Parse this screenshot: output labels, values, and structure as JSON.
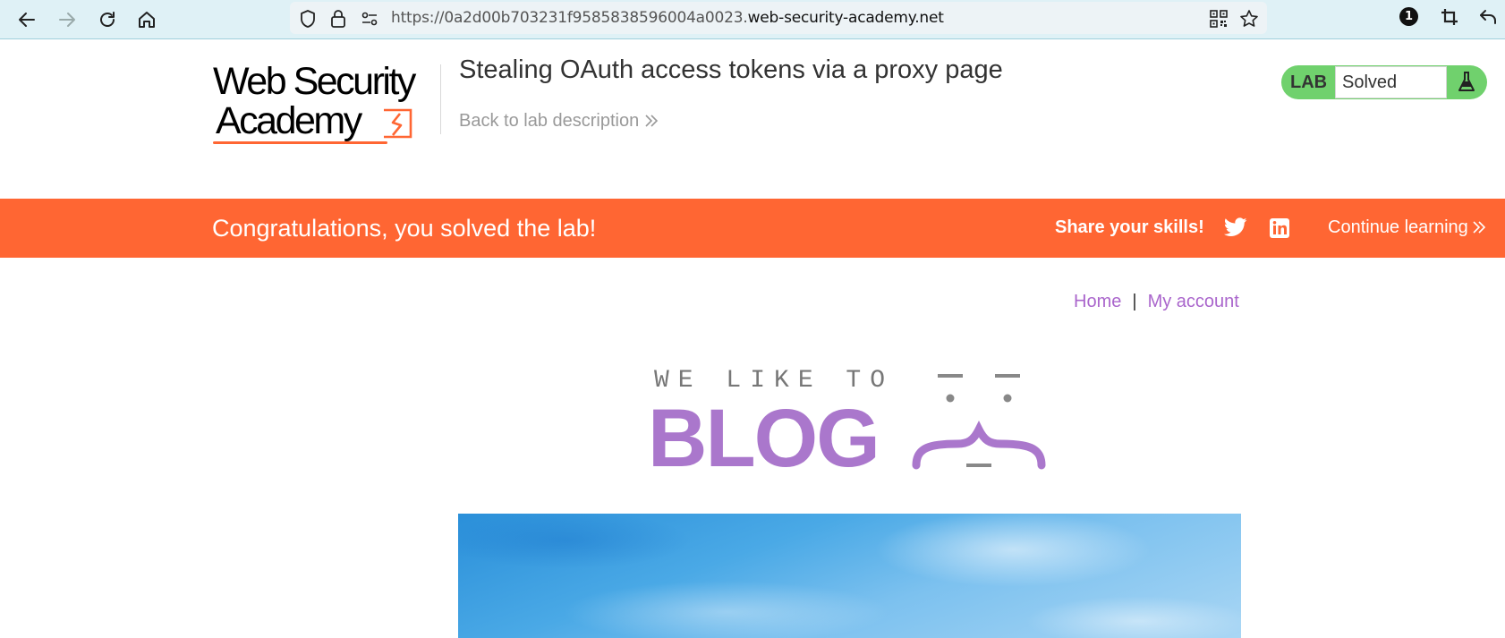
{
  "browser": {
    "url_prefix": "https://0a2d00b703231f9585838596004a0023.",
    "url_host": "web-security-academy.net",
    "extension_badge": "1"
  },
  "lab": {
    "logo_line1": "Web Security",
    "logo_line2": "Academy",
    "title": "Stealing OAuth access tokens via a proxy page",
    "back_link": "Back to lab description",
    "status_label": "LAB",
    "status_value": "Solved"
  },
  "banner": {
    "message": "Congratulations, you solved the lab!",
    "share_label": "Share your skills!",
    "continue_label": "Continue learning"
  },
  "blog": {
    "nav_home": "Home",
    "nav_separator": "|",
    "nav_account": "My account",
    "tagline": "WE LIKE TO",
    "wordmark": "BLOG"
  },
  "colors": {
    "accent_orange": "#ff6633",
    "lab_green": "#70d16d",
    "blog_purple": "#aa77cc",
    "link_purple": "#aa66cc",
    "browser_bar": "#dff1f6"
  }
}
